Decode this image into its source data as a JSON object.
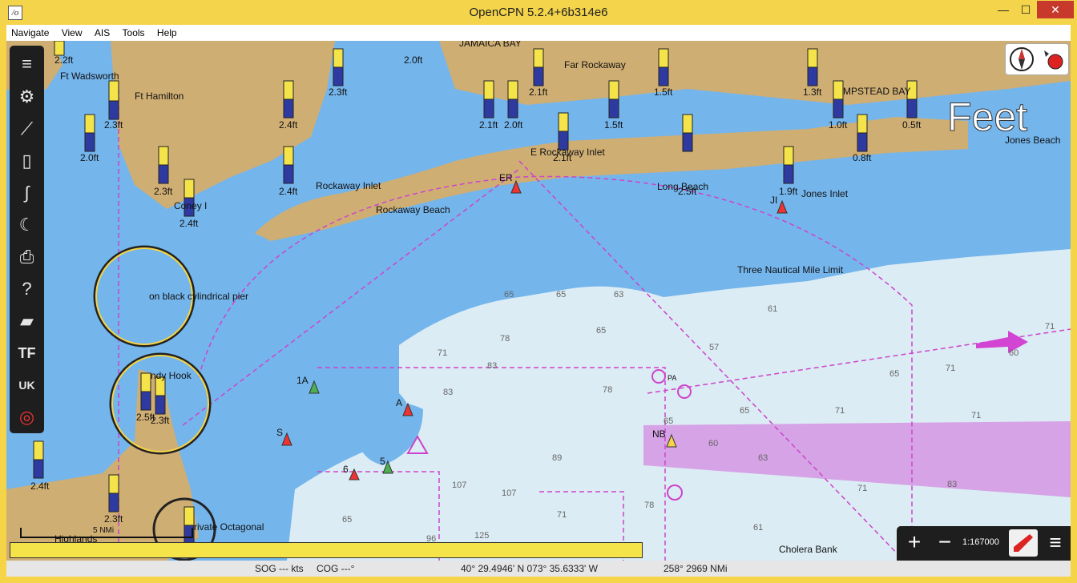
{
  "window": {
    "title": "OpenCPN 5.2.4+6b314e6",
    "min_label": "—",
    "max_label": "☐",
    "close_label": "✕"
  },
  "menu": [
    "Navigate",
    "View",
    "AIS",
    "Tools",
    "Help"
  ],
  "toolbar": {
    "items": [
      {
        "icon": "menu-icon",
        "glyph": "≡"
      },
      {
        "icon": "settings-gear-icon",
        "glyph": "⚙"
      },
      {
        "icon": "route-icon",
        "glyph": "⟋"
      },
      {
        "icon": "document-icon",
        "glyph": "▯"
      },
      {
        "icon": "track-icon",
        "glyph": "∫"
      },
      {
        "icon": "night-mode-icon",
        "glyph": "☾"
      },
      {
        "icon": "print-icon",
        "glyph": "⎙"
      },
      {
        "icon": "help-icon",
        "glyph": "?"
      },
      {
        "icon": "layers-icon",
        "glyph": "▰"
      },
      {
        "icon": "tide-current-icon",
        "glyph": "TF"
      },
      {
        "icon": "uk-ruler-icon",
        "glyph": "UK"
      },
      {
        "icon": "mob-lifebuoy-icon",
        "glyph": "◎"
      }
    ]
  },
  "map": {
    "feet_label": "Feet",
    "labels": [
      {
        "id": "jamaica-bay",
        "text": "JAMAICA BAY"
      },
      {
        "id": "far-rockaway",
        "text": "Far Rockaway"
      },
      {
        "id": "ft-wadsworth",
        "text": "Ft Wadsworth"
      },
      {
        "id": "ft-hamilton",
        "text": "Ft Hamilton"
      },
      {
        "id": "hempstead-bay",
        "text": "MPSTEAD BAY"
      },
      {
        "id": "jones-beach",
        "text": "Jones Beach"
      },
      {
        "id": "e-rockaway-inlet",
        "text": "E Rockaway Inlet"
      },
      {
        "id": "rockaway-inlet",
        "text": "Rockaway Inlet"
      },
      {
        "id": "rockaway-beach",
        "text": "Rockaway Beach"
      },
      {
        "id": "long-beach",
        "text": "Long Beach"
      },
      {
        "id": "jones-inlet",
        "text": "Jones Inlet"
      },
      {
        "id": "coney-island",
        "text": "Coney I"
      },
      {
        "id": "three-mile-limit",
        "text": "Three Nautical Mile Limit"
      },
      {
        "id": "pier",
        "text": "on black cylindrical pier"
      },
      {
        "id": "sandy-hook",
        "text": "ndy Hook"
      },
      {
        "id": "private-octagonal",
        "text": "rivate Octagonal"
      },
      {
        "id": "highlands",
        "text": "Highlands"
      },
      {
        "id": "cholera-bank",
        "text": "Cholera Bank"
      },
      {
        "id": "er-buoy",
        "text": "ER"
      },
      {
        "id": "ji-buoy",
        "text": "JI"
      },
      {
        "id": "nb-buoy",
        "text": "NB"
      },
      {
        "id": "buoy-1a",
        "text": "1A"
      },
      {
        "id": "buoy-a",
        "text": "A"
      },
      {
        "id": "buoy-s",
        "text": "S"
      },
      {
        "id": "buoy-6",
        "text": "6"
      },
      {
        "id": "buoy-5",
        "text": "5"
      },
      {
        "id": "pa-mark",
        "text": "PA"
      }
    ],
    "tides": [
      "2.2ft",
      "2.0ft",
      "2.3ft",
      "2.3ft",
      "2.4ft",
      "2.1ft",
      "2.1ft",
      "2.0ft",
      "1.5ft",
      "1.5ft",
      "1.3ft",
      "1.0ft",
      "0.5ft",
      "2.0ft",
      "2.3ft",
      "2.4ft",
      "2.4ft",
      "2.1ft",
      "2.5ft",
      "1.9ft",
      "0.8ft",
      "2.5ft",
      "2.3ft",
      "2.4ft",
      "2.3ft"
    ],
    "depths": [
      "65",
      "65",
      "63",
      "65",
      "71",
      "78",
      "83",
      "83",
      "78",
      "57",
      "61",
      "71",
      "60",
      "65",
      "71",
      "71",
      "65",
      "71",
      "89",
      "107",
      "107",
      "71",
      "78",
      "63",
      "60",
      "65",
      "125",
      "96",
      "71",
      "83",
      "61",
      "65"
    ],
    "scale_bar": "5 NMi"
  },
  "compass": {
    "icon": "compass-north-icon"
  },
  "zoom": {
    "zoom_in": "+",
    "zoom_out": "−",
    "scale": "1:167000"
  },
  "status": {
    "sog": "SOG --- kts",
    "cog": "COG ---°",
    "position": "40° 29.4946' N   073° 35.6333' W",
    "bearing": "258°  2969 NMi"
  }
}
